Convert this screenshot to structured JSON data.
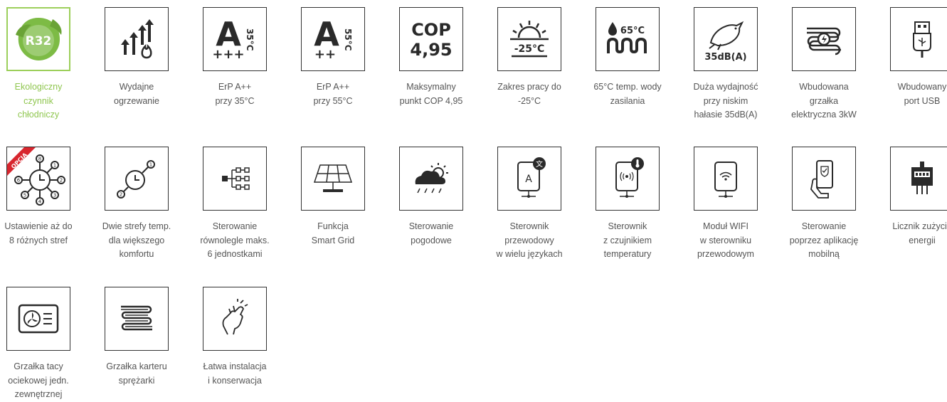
{
  "colors": {
    "accent_green": "#8fc64f",
    "border": "#333333",
    "text": "#555555"
  },
  "features": [
    {
      "icon": "r32-leaf-icon",
      "icon_text": "R32",
      "caption": "Ekologiczny\nczynnik\nchłodniczy",
      "selected": true
    },
    {
      "icon": "efficient-heating-icon",
      "caption": "Wydajne\nogrzewanie"
    },
    {
      "icon": "erp-a35-icon",
      "icon_text": [
        "A",
        "35°C",
        "+++"
      ],
      "caption": "ErP A++\nprzy 35°C"
    },
    {
      "icon": "erp-a55-icon",
      "icon_text": [
        "A",
        "55°C",
        "++"
      ],
      "caption": "ErP A++\nprzy 55°C"
    },
    {
      "icon": "cop-icon",
      "icon_text": [
        "COP",
        "4,95"
      ],
      "caption": "Maksymalny\npunkt COP 4,95"
    },
    {
      "icon": "sun-temperature-icon",
      "icon_text": "-25°C",
      "caption": "Zakres pracy do\n-25°C"
    },
    {
      "icon": "water-temperature-icon",
      "icon_text": "65°C",
      "caption": "65°C temp. wody\nzasilania"
    },
    {
      "icon": "quiet-bird-icon",
      "icon_text": "35dB(A)",
      "caption": "Duża wydajność\nprzy niskim\nhałasie 35dB(A)"
    },
    {
      "icon": "electric-heater-icon",
      "caption": "Wbudowana\ngrzałka\nelektryczna 3kW"
    },
    {
      "icon": "usb-port-icon",
      "caption": "Wbudowany\nport USB"
    },
    {
      "icon": "zones-clock-icon",
      "icon_text": [
        "OPCJA",
        "1",
        "2",
        "3",
        "4",
        "5",
        "6",
        "8"
      ],
      "caption": "Ustawienie aż do\n8 różnych stref"
    },
    {
      "icon": "two-zones-clock-icon",
      "icon_text": [
        "1",
        "2"
      ],
      "caption": "Dwie strefy temp.\ndla większego\nkomfortu"
    },
    {
      "icon": "parallel-control-icon",
      "caption": "Sterowanie\nrównolegle maks.\n6 jednostkami"
    },
    {
      "icon": "solar-panel-icon",
      "caption": "Funkcja\nSmart Grid"
    },
    {
      "icon": "weather-icon",
      "caption": "Sterowanie\npogodowe"
    },
    {
      "icon": "language-controller-icon",
      "icon_text": [
        "A",
        "文"
      ],
      "caption": "Sterownik\nprzewodowy\nw wielu językach"
    },
    {
      "icon": "sensor-controller-icon",
      "caption": "Sterownik\nz czujnikiem\ntemperatury"
    },
    {
      "icon": "wifi-module-icon",
      "caption": "Moduł WIFI\nw sterowniku\nprzewodowym"
    },
    {
      "icon": "mobile-app-icon",
      "caption": "Sterowanie\npoprzez aplikację\nmobilną"
    },
    {
      "icon": "energy-meter-icon",
      "caption": "Licznik zużycia\nenergii"
    },
    {
      "icon": "tray-heater-icon",
      "caption": "Grzałka tacy\nociekowej jedn.\nzewnętrznej"
    },
    {
      "icon": "crankcase-heater-icon",
      "caption": "Grzałka karteru\nsprężarki"
    },
    {
      "icon": "easy-install-icon",
      "caption": "Łatwa instalacja\ni konserwacja"
    }
  ]
}
